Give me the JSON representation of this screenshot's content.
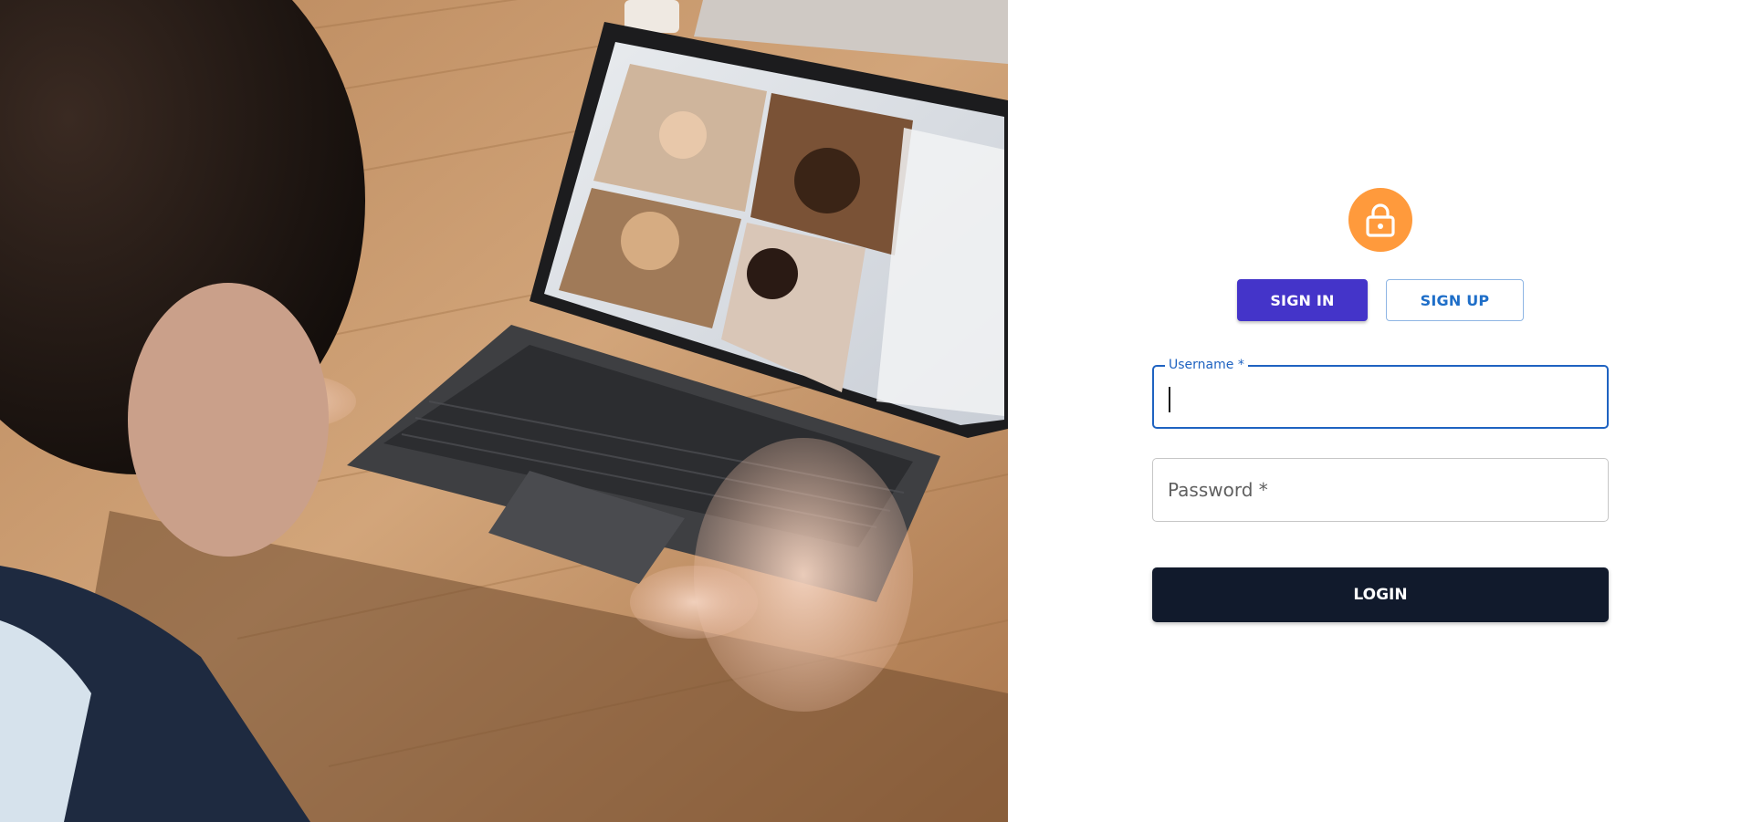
{
  "hero": {
    "image_description": "Person on a video call using a tablet laptop at a wooden table",
    "icon": "photo-hero"
  },
  "auth": {
    "avatar_icon": "lock-icon",
    "avatar_color": "#ff9a3c",
    "tabs": {
      "sign_in_label": "SIGN IN",
      "sign_up_label": "SIGN UP",
      "active": "SIGN IN",
      "active_color": "#4434c9"
    },
    "fields": {
      "username_label": "Username *",
      "username_value": "",
      "password_label": "Password *",
      "password_value": ""
    },
    "login_label": "LOGIN",
    "login_color": "#111a2c"
  }
}
